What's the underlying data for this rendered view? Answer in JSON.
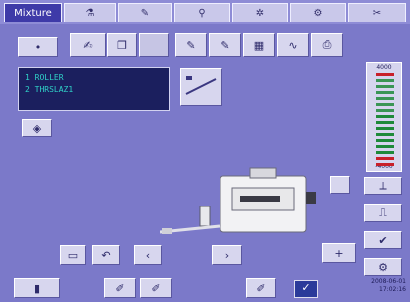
{
  "tabs": [
    {
      "label": "Mixture",
      "icon": "logo-icon"
    },
    {
      "label": "",
      "icon": "flask-icon"
    },
    {
      "label": "",
      "icon": "tool-icon"
    },
    {
      "label": "",
      "icon": "probe-icon"
    },
    {
      "label": "",
      "icon": "tune-icon"
    },
    {
      "label": "",
      "icon": "settings-icon"
    },
    {
      "label": "",
      "icon": "wrench-icon"
    }
  ],
  "toolbar": {
    "menu_label": "•",
    "items": [
      "scan-icon",
      "copy-icon",
      "blank",
      "edit-icon",
      "edit2-icon",
      "table-icon",
      "chart-icon",
      "print-icon"
    ]
  },
  "status": {
    "line1": "1 ROLLER",
    "line2": "2 THRSLAZ1"
  },
  "meter": {
    "top_label": "4000",
    "bottom_label": "-4000",
    "level": 0.55,
    "colors": {
      "green": "#1e8a3a",
      "red": "#c8202a"
    }
  },
  "footer": {
    "date": "2008-06-01",
    "time": "17:02:16"
  },
  "nav": {
    "back": "↶",
    "prev": "‹",
    "next": "›"
  },
  "colors": {
    "background": "#7b79c9",
    "tab_active": "#3e3aa8",
    "panel_text": "#2fd2c8"
  }
}
